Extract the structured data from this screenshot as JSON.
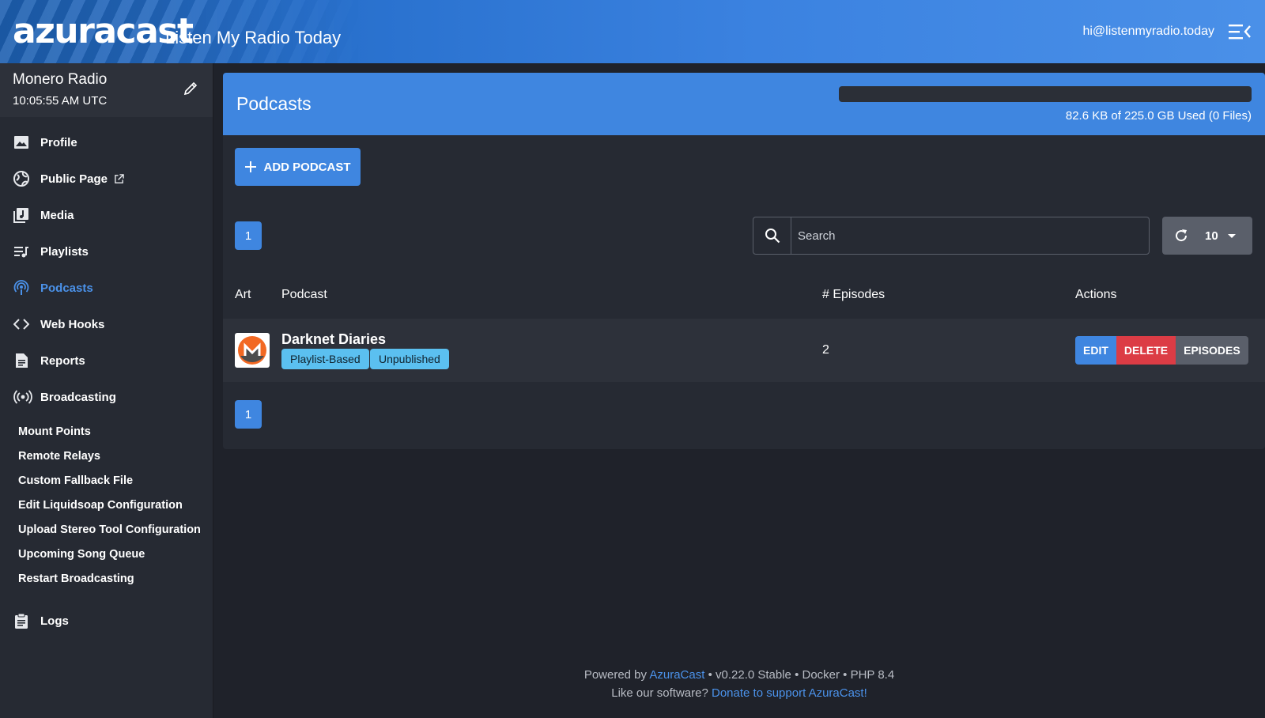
{
  "header": {
    "logo": "azuracast",
    "station_title": "Listen My Radio Today",
    "user_email": "hi@listenmyradio.today"
  },
  "sidebar": {
    "station_name": "Monero Radio",
    "time": "10:05:55 AM UTC",
    "items": [
      {
        "label": "Profile",
        "icon": "profile-icon"
      },
      {
        "label": "Public Page",
        "icon": "globe-icon"
      },
      {
        "label": "Media",
        "icon": "media-icon"
      },
      {
        "label": "Playlists",
        "icon": "playlist-icon"
      },
      {
        "label": "Podcasts",
        "icon": "podcast-icon",
        "active": true
      },
      {
        "label": "Web Hooks",
        "icon": "code-icon"
      },
      {
        "label": "Reports",
        "icon": "reports-icon"
      },
      {
        "label": "Broadcasting",
        "icon": "broadcast-icon"
      }
    ],
    "sub_items": [
      "Mount Points",
      "Remote Relays",
      "Custom Fallback File",
      "Edit Liquidsoap Configuration",
      "Upload Stereo Tool Configuration",
      "Upcoming Song Queue",
      "Restart Broadcasting"
    ],
    "logs_label": "Logs"
  },
  "main": {
    "title": "Podcasts",
    "quota_text": "82.6 KB of 225.0 GB Used (0 Files)",
    "add_button": "ADD PODCAST",
    "page_number": "1",
    "search_placeholder": "Search",
    "per_page": "10",
    "columns": {
      "art": "Art",
      "podcast": "Podcast",
      "episodes": "# Episodes",
      "actions": "Actions"
    },
    "rows": [
      {
        "name": "Darknet Diaries",
        "badges": [
          "Playlist-Based",
          "Unpublished"
        ],
        "episodes": "2",
        "actions": {
          "edit": "EDIT",
          "delete": "DELETE",
          "episodes": "EPISODES"
        }
      }
    ]
  },
  "footer": {
    "powered_prefix": "Powered by",
    "powered_link": "AzuraCast",
    "version": "• v0.22.0 Stable • Docker • PHP 8.4",
    "like_prefix": "Like our software?",
    "donate_link": "Donate to support AzuraCast!"
  },
  "colors": {
    "accent": "#3f86e0",
    "danger": "#dc3c45",
    "badge": "#5bc0f0",
    "background": "#1f222a"
  }
}
